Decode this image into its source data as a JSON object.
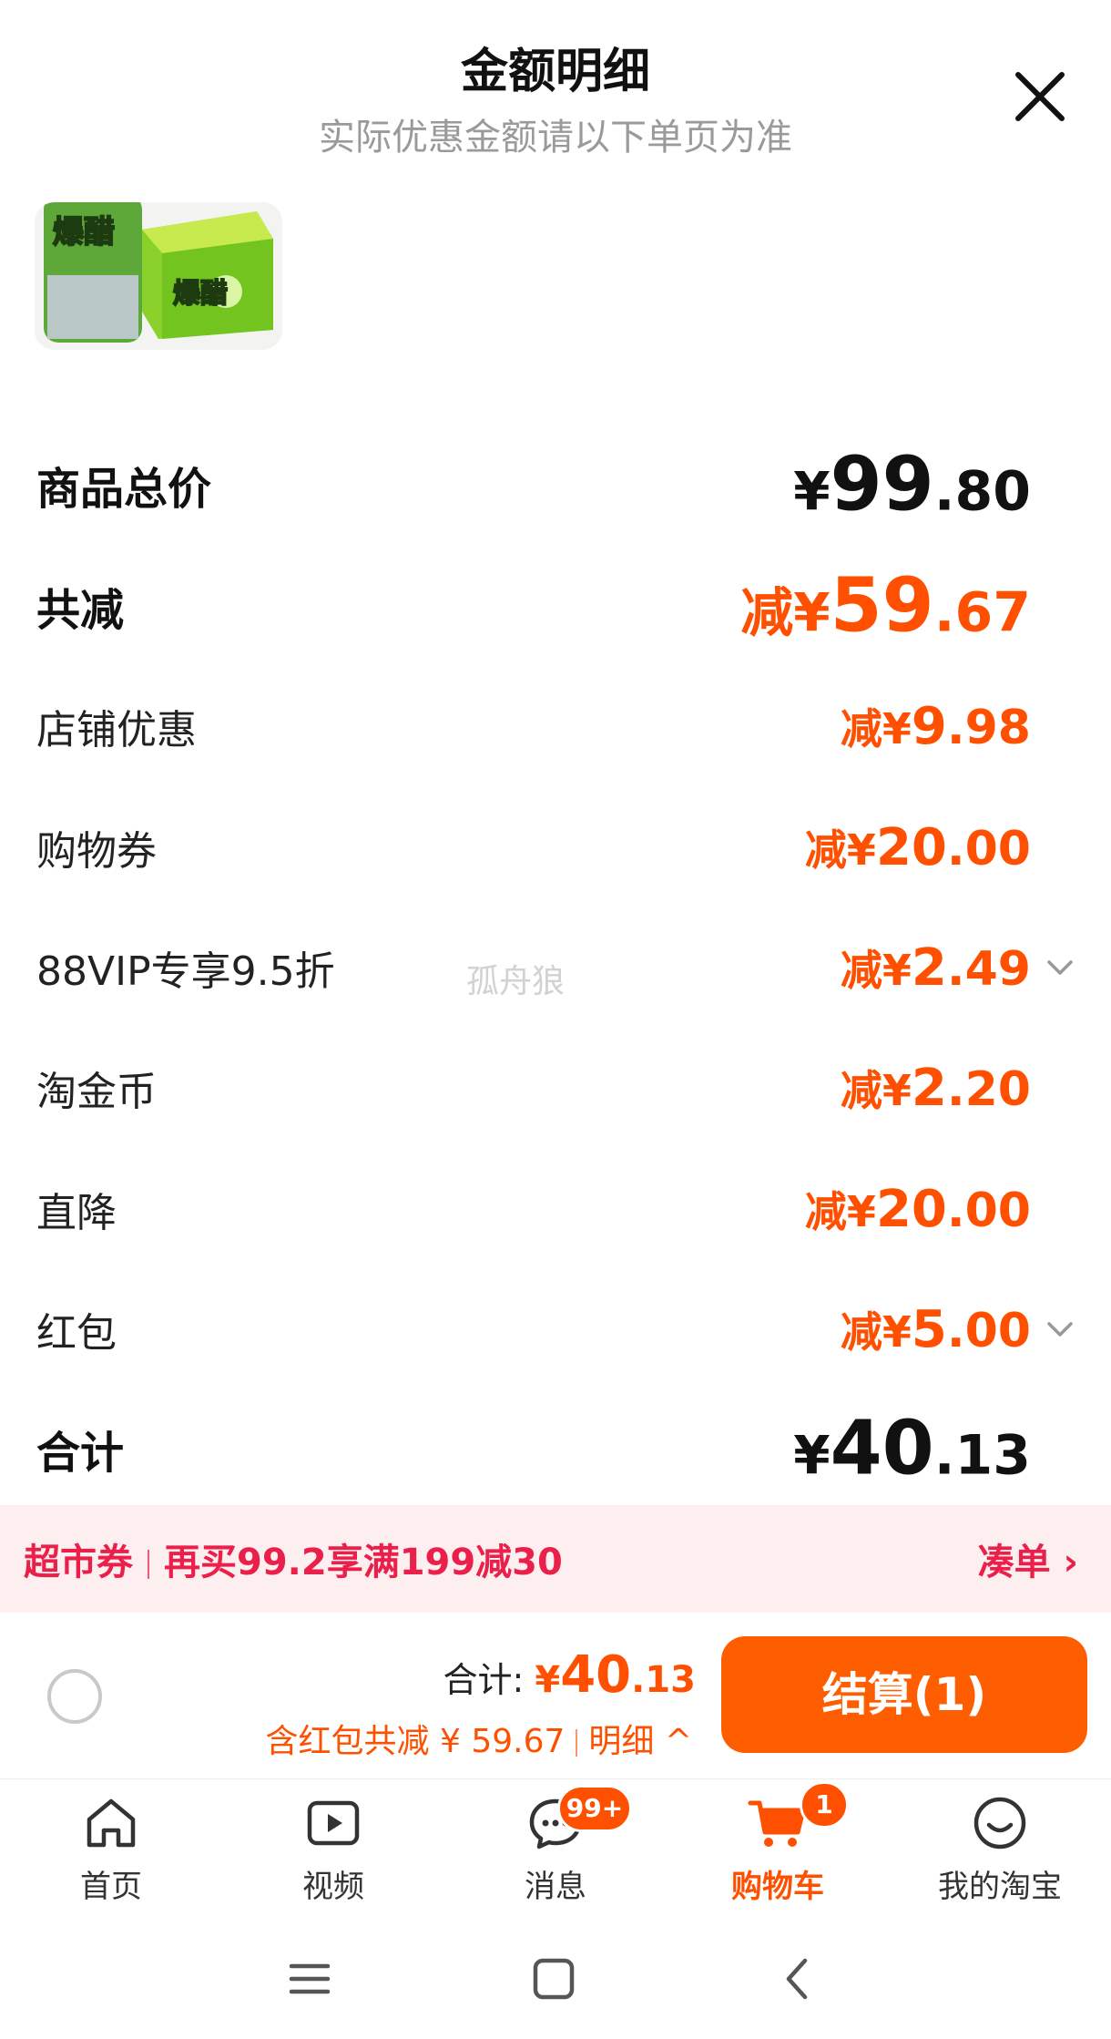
{
  "header": {
    "title": "金额明细",
    "subtitle": "实际优惠金额请以下单页为准"
  },
  "product": {
    "image_icon": "soda-box-image",
    "image_text": "爆醋"
  },
  "summary": {
    "goods_total": {
      "label": "商品总价",
      "currency": "¥",
      "int": "99",
      "dec": ".80"
    },
    "total_discount": {
      "label": "共减",
      "prefix": "减¥",
      "int": "59",
      "dec": ".67"
    }
  },
  "discounts": [
    {
      "label": "店铺优惠",
      "prefix": "减¥",
      "int": "9",
      "dec": ".98",
      "expandable": false
    },
    {
      "label": "购物券",
      "prefix": "减¥",
      "int": "20",
      "dec": ".00",
      "expandable": false
    },
    {
      "label": "88VIP专享9.5折",
      "prefix": "减¥",
      "int": "2",
      "dec": ".49",
      "expandable": true
    },
    {
      "label": "淘金币",
      "prefix": "减¥",
      "int": "2",
      "dec": ".20",
      "expandable": false
    },
    {
      "label": "直降",
      "prefix": "减¥",
      "int": "20",
      "dec": ".00",
      "expandable": false
    },
    {
      "label": "红包",
      "prefix": "减¥",
      "int": "5",
      "dec": ".00",
      "expandable": true
    }
  ],
  "grand_total": {
    "label": "合计",
    "currency": "¥",
    "int": "40",
    "dec": ".13"
  },
  "watermark": "孤舟狼",
  "promo": {
    "tag": "超市券",
    "text": "再买99.2享满199减30",
    "action": "凑单 ›"
  },
  "checkout": {
    "total_label": "合计:",
    "currency": "¥",
    "int": "40",
    "dec": ".13",
    "discount_text": "含红包共减 ¥ 59.67",
    "detail_link": "明细 ^",
    "pay_button": "结算(1)"
  },
  "tabbar": [
    {
      "label": "首页",
      "icon": "home-icon",
      "active": false
    },
    {
      "label": "视频",
      "icon": "video-icon",
      "active": false
    },
    {
      "label": "消息",
      "icon": "message-icon",
      "active": false,
      "badge": "99+"
    },
    {
      "label": "购物车",
      "icon": "cart-icon",
      "active": true,
      "badge": "1"
    },
    {
      "label": "我的淘宝",
      "icon": "profile-icon",
      "active": false
    }
  ],
  "colors": {
    "accent": "#fe5000",
    "promo_text": "#ea1f4a",
    "promo_bg": "#fdeef0",
    "pay_button": "#ff5e00"
  }
}
